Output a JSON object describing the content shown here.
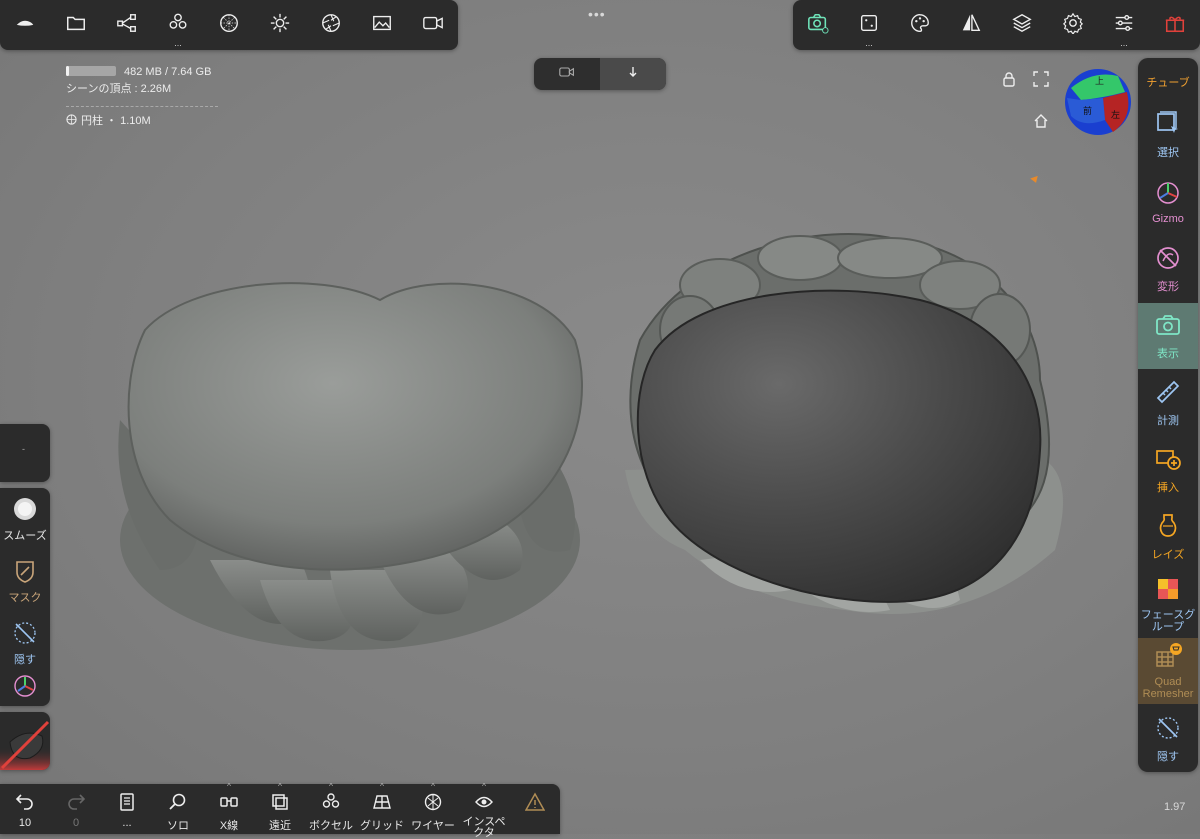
{
  "topbar_left": {
    "icons": [
      "logo-icon",
      "folder-icon",
      "share-nodes-icon",
      "voxels-icon",
      "sphere-grid-icon",
      "light-icon",
      "aperture-icon",
      "image-icon",
      "video-icon"
    ]
  },
  "topbar_right": {
    "icons": [
      "camera-icon",
      "dice-icon",
      "palette-icon",
      "symmetry-icon",
      "layers-icon",
      "settings-icon",
      "sliders-icon",
      "gift-icon"
    ]
  },
  "stats": {
    "memory": "482 MB / 7.64 GB",
    "vertices": "シーンの頂点 : 2.26M",
    "object": "円柱 ・ 1.10M"
  },
  "camera_toggle": {
    "left_icon": "video-camera-icon",
    "right_icon": "arrow-down-icon"
  },
  "nav_cube": {
    "top": "上",
    "front": "前",
    "left": "左"
  },
  "right_sidebar": {
    "items": [
      {
        "label": "チューブ",
        "color": "#f0a030"
      },
      {
        "label": "選択",
        "color": "#9ec6f2"
      },
      {
        "label": "Gizmo",
        "color": "#e48fd0"
      },
      {
        "label": "変形",
        "color": "#e48fd0"
      },
      {
        "label": "表示",
        "color": "#7fe6c6"
      },
      {
        "label": "計測",
        "color": "#9ec6f2"
      },
      {
        "label": "挿入",
        "color": "#f5a623"
      },
      {
        "label": "レイズ",
        "color": "#f5a623"
      },
      {
        "label": "フェースグループ",
        "color": "#9ec6f2"
      },
      {
        "label": "Quad Remesher",
        "color": "#b08d55"
      },
      {
        "label": "隠す",
        "color": "#9ec6f2"
      }
    ]
  },
  "left_tools": {
    "items": [
      {
        "label": "スムーズ"
      },
      {
        "label": "マスク"
      },
      {
        "label": "隠す"
      }
    ],
    "small_panel_text": "-"
  },
  "bottombar": {
    "items": [
      {
        "label": "10",
        "icon": "undo-icon"
      },
      {
        "label": "0",
        "icon": "redo-icon"
      },
      {
        "label": "...",
        "icon": "book-icon"
      },
      {
        "label": "ソロ",
        "icon": "search-icon"
      },
      {
        "label": "X線",
        "icon": "xray-glasses-icon"
      },
      {
        "label": "遠近",
        "icon": "perspective-icon"
      },
      {
        "label": "ボクセル",
        "icon": "voxel-icon"
      },
      {
        "label": "グリッド",
        "icon": "grid-icon"
      },
      {
        "label": "ワイヤー",
        "icon": "wireframe-icon"
      },
      {
        "label": "インスペクタ",
        "icon": "eye-icon"
      },
      {
        "label": "",
        "icon": "warning-icon"
      }
    ]
  },
  "version": "1.97"
}
